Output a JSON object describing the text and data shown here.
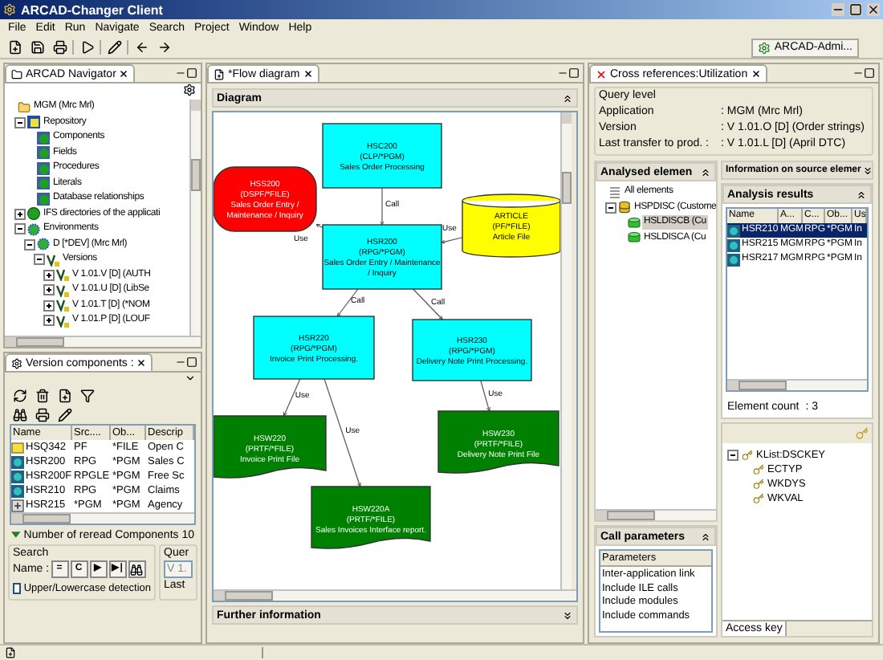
{
  "window": {
    "title": "ARCAD-Changer Client"
  },
  "menu": [
    "File",
    "Edit",
    "Run",
    "Navigate",
    "Search",
    "Project",
    "Window",
    "Help"
  ],
  "perspective": {
    "label": "ARCAD-Admi..."
  },
  "navigator": {
    "title": "ARCAD Navigator",
    "tree": [
      {
        "label": "MGM (Mrc Mrl)",
        "kind": "folder",
        "children": [
          {
            "label": "Repository",
            "kind": "repository",
            "expanded": true,
            "children": [
              {
                "label": "Components",
                "kind": "node"
              },
              {
                "label": "Fields",
                "kind": "node"
              },
              {
                "label": "Procedures",
                "kind": "node"
              },
              {
                "label": "Literals",
                "kind": "node"
              },
              {
                "label": "Database relationships",
                "kind": "node"
              }
            ]
          },
          {
            "label": "IFS directories of the applicati",
            "kind": "globe",
            "expanded": false
          },
          {
            "label": "Environments",
            "kind": "ring",
            "expanded": true,
            "children": [
              {
                "label": "D [*DEV] (Mrc Mrl)",
                "kind": "ring",
                "expanded": true,
                "children": [
                  {
                    "label": "Versions",
                    "kind": "version",
                    "expanded": true,
                    "children": [
                      {
                        "label": "V 1.01.V [D] (AUTH",
                        "kind": "version",
                        "expanded": false
                      },
                      {
                        "label": "V 1.01.U [D] (LibSe",
                        "kind": "version",
                        "expanded": false
                      },
                      {
                        "label": "V 1.01.T [D] (*NOM",
                        "kind": "version",
                        "expanded": false
                      },
                      {
                        "label": "V 1.01.P [D] (LOUF",
                        "kind": "version",
                        "expanded": false
                      }
                    ]
                  }
                ]
              }
            ]
          }
        ]
      }
    ]
  },
  "version_components": {
    "title": "Version components :",
    "columns": [
      "Name",
      "Src....",
      "Ob...",
      "Descrip"
    ],
    "rows": [
      {
        "kind": "file",
        "cells": [
          "HSQ342",
          "PF",
          "*FILE",
          "Open C"
        ]
      },
      {
        "kind": "program",
        "cells": [
          "HSR200",
          "RPG",
          "*PGM",
          "Sales C"
        ]
      },
      {
        "kind": "program",
        "cells": [
          "HSR200F",
          "RPGLE",
          "*PGM",
          "Free Sc"
        ]
      },
      {
        "kind": "program",
        "cells": [
          "HSR210",
          "RPG",
          "*PGM",
          "Claims"
        ]
      },
      {
        "kind": "service",
        "cells": [
          "HSR215",
          "*PGM",
          "*PGM",
          "Agency"
        ]
      }
    ],
    "count_label": "Number of reread Components 10",
    "search": {
      "legend": "Search",
      "name_label": "Name :",
      "buttons": [
        "=",
        "C",
        "▶",
        "▶|"
      ],
      "checkbox": {
        "label": "Upper/Lowercase detection",
        "checked": false
      }
    },
    "query": {
      "legend": "Quer",
      "value": "V 1.",
      "disabled": true,
      "label": "Last"
    }
  },
  "flow_diagram": {
    "tab": "*Flow diagram",
    "section": "Diagram",
    "footer_section": "Further information",
    "nodes": [
      {
        "kind": "program",
        "lines": [
          "HSC200",
          "(CLP/*PGM)",
          "Sales Order Processing"
        ]
      },
      {
        "kind": "display_file",
        "lines": [
          "HSS200",
          "(DSPF/*FILE)",
          "Sales Order Entry /",
          "Maintenance / Inquiry"
        ]
      },
      {
        "kind": "physical_file",
        "lines": [
          "ARTICLE",
          "(PF/*FILE)",
          "Article File"
        ]
      },
      {
        "kind": "program",
        "lines": [
          "HSR200",
          "(RPG/*PGM)",
          "Sales Order Entry / Maintenance",
          "/ Inquiry"
        ]
      },
      {
        "kind": "program",
        "lines": [
          "HSR220",
          "(RPG/*PGM)",
          "Invoice Print Processing."
        ]
      },
      {
        "kind": "program",
        "lines": [
          "HSR230",
          "(RPG/*PGM)",
          "Delivery Note Print Processing."
        ]
      },
      {
        "kind": "printer_file",
        "lines": [
          "HSW220",
          "(PRTF/*FILE)",
          "Invoice Print File"
        ]
      },
      {
        "kind": "printer_file",
        "lines": [
          "HSW230",
          "(PRTF/*FILE)",
          "Delivery Note Print File"
        ]
      },
      {
        "kind": "printer_file",
        "lines": [
          "HSW220A",
          "(PRTF/*FILE)",
          "Sales Invoices Interface report."
        ]
      }
    ],
    "edges": [
      {
        "label": "Call"
      },
      {
        "label": "Use"
      },
      {
        "label": "Use"
      },
      {
        "label": "Call"
      },
      {
        "label": "Call"
      },
      {
        "label": "Use"
      },
      {
        "label": "Use"
      },
      {
        "label": "Use"
      }
    ]
  },
  "cross_references": {
    "tab": "Cross references:Utilization",
    "query_level": {
      "legend": "Query level",
      "rows": [
        {
          "label": "Application",
          "value": ": MGM (Mrc Mrl)"
        },
        {
          "label": "Version",
          "value": ": V 1.01.O [D] (Order strings)"
        },
        {
          "label": "Last transfer to prod. :",
          "value": ": V 1.01.L [D] (April DTC)"
        }
      ]
    },
    "analysed": {
      "title": "Analysed elemen",
      "tree": [
        {
          "label": "All elements",
          "kind": "list",
          "selected": false,
          "children": [
            {
              "label": "HSPDISC (Custome",
              "kind": "db",
              "expanded": true,
              "selected": false,
              "children": [
                {
                  "label": "HSLDISCB (Cu",
                  "kind": "table",
                  "selected": true
                },
                {
                  "label": "HSLDISCA (Cu",
                  "kind": "table",
                  "selected": false
                }
              ]
            }
          ]
        }
      ]
    },
    "call_parameters": {
      "title": "Call parameters",
      "column": "Parameters",
      "rows": [
        "Inter-application link",
        "Include ILE calls",
        "Include modules",
        "Include commands"
      ]
    },
    "source_info": {
      "title": "Information on source elemer"
    },
    "analysis_results": {
      "title": "Analysis results",
      "columns": [
        "Name",
        "A...",
        "C...",
        "Ob...",
        "Us"
      ],
      "rows": [
        {
          "cells": [
            "HSR210",
            "MGM",
            "RPG",
            "*PGM",
            "In"
          ],
          "selected": true
        },
        {
          "cells": [
            "HSR215",
            "MGM",
            "RPG",
            "*PGM",
            "In"
          ],
          "selected": false
        },
        {
          "cells": [
            "HSR217",
            "MGM",
            "RPG",
            "*PGM",
            "In"
          ],
          "selected": false
        }
      ],
      "count_label": "Element count",
      "count": ": 3"
    },
    "key_tree": {
      "root": "KList:DSCKEY",
      "expanded": true,
      "children": [
        "ECTYP",
        "WKDYS",
        "WKVAL"
      ]
    },
    "access_key": "Access key"
  }
}
